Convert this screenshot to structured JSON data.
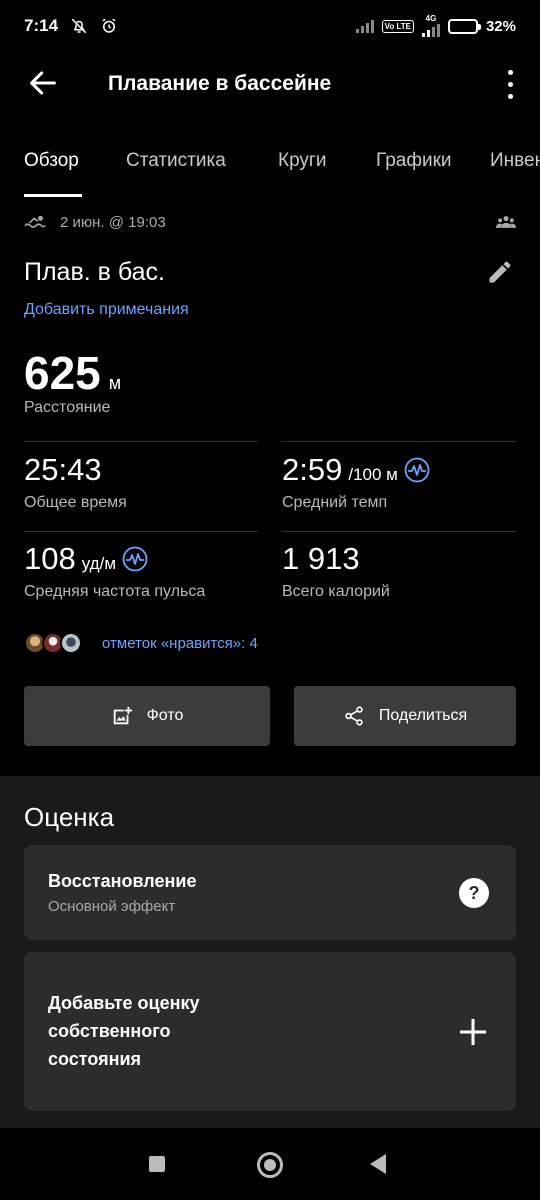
{
  "status": {
    "time": "7:14",
    "network": "4G",
    "volte": "Vo LTE",
    "battery": "32%",
    "battery_level": 0.32
  },
  "header": {
    "title": "Плавание в бассейне"
  },
  "tabs": [
    {
      "label": "Обзор"
    },
    {
      "label": "Статистика"
    },
    {
      "label": "Круги"
    },
    {
      "label": "Графики"
    },
    {
      "label": "Инвентарь"
    }
  ],
  "activity": {
    "date": "2 июн. @ 19:03",
    "name": "Плав. в бас.",
    "add_note": "Добавить примечания"
  },
  "distance": {
    "value": "625",
    "unit": "м",
    "label": "Расстояние"
  },
  "stats": {
    "total_time": {
      "value": "25:43",
      "label": "Общее время"
    },
    "avg_pace": {
      "value": "2:59",
      "unit": "/100 м",
      "label": "Средний темп"
    },
    "avg_hr": {
      "value": "108",
      "unit": "уд/м",
      "label": "Средняя частота пульса"
    },
    "calories": {
      "value": "1 913",
      "label": "Всего калорий"
    }
  },
  "likes": {
    "text": "отметок «нравится»: 4"
  },
  "buttons": {
    "photo": "Фото",
    "share": "Поделиться"
  },
  "assessment": {
    "title": "Оценка",
    "recovery_title": "Восстановление",
    "recovery_sub": "Основной эффект",
    "self_line1": "Добавьте оценку",
    "self_line2": "собственного",
    "self_line3": "состояния"
  },
  "colors": {
    "accent": "#6aa3ff",
    "background": "#000000",
    "card": "#2c2c2c",
    "section": "#1a1a1a"
  }
}
